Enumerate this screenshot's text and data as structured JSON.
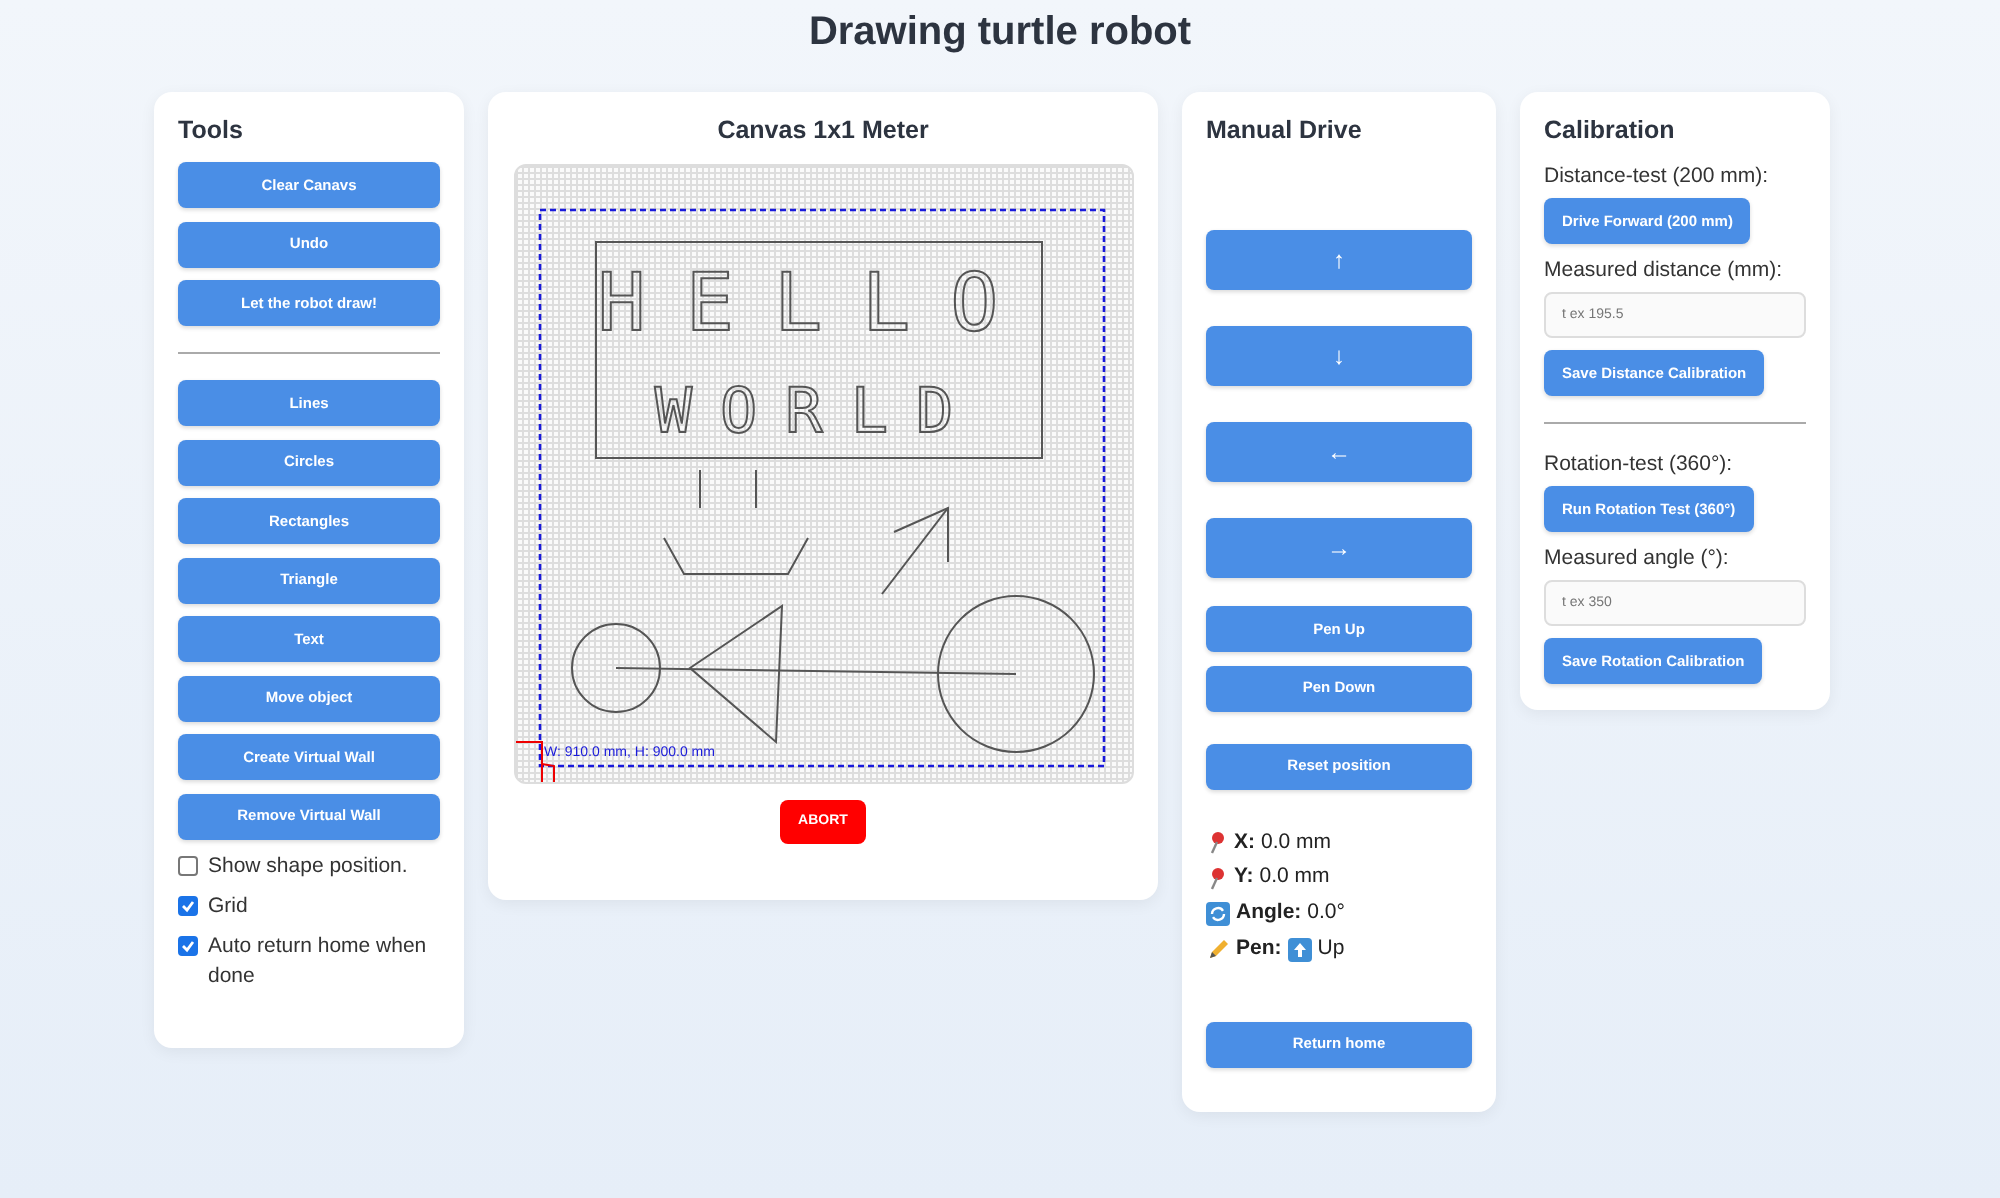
{
  "title": "Drawing turtle robot",
  "tools": {
    "title": "Tools",
    "buttons": [
      "Clear Canavs",
      "Undo",
      "Let the robot draw!"
    ],
    "shape_buttons": [
      "Lines",
      "Circles",
      "Rectangles",
      "Triangle",
      "Text",
      "Move object",
      "Create Virtual Wall",
      "Remove Virtual Wall"
    ],
    "options": [
      {
        "label": "Show shape position.",
        "checked": false
      },
      {
        "label": "Grid",
        "checked": true
      },
      {
        "label": "Auto return home when done",
        "checked": true
      }
    ]
  },
  "canvas": {
    "title": "Canvas 1x1 Meter",
    "grid": true,
    "text_lines": [
      "HELLO",
      "WORLD"
    ],
    "wall_label": "W: 910.0 mm, H: 900.0 mm",
    "abort_button": "ABORT"
  },
  "manual_drive": {
    "title": "Manual Drive",
    "arrows": [
      "↑",
      "↓",
      "←",
      "→"
    ],
    "buttons": [
      "Pen Up",
      "Pen Down"
    ],
    "reset_button": "Reset position",
    "status": [
      {
        "kind": "pin",
        "label": "X:",
        "value": "0.0 mm"
      },
      {
        "kind": "pin",
        "label": "Y:",
        "value": "0.0 mm"
      },
      {
        "kind": "rotate",
        "label": "Angle:",
        "value": "0.0°"
      },
      {
        "kind": "pen",
        "label": "Pen:",
        "value": "Up"
      }
    ],
    "home_button": "Return home"
  },
  "calibration": {
    "title": "Calibration",
    "sections": [
      {
        "label": "Distance-test (200 mm):",
        "test_button": "Drive Forward (200 mm)",
        "field_label": "Measured distance (mm):",
        "placeholder": "t ex 195.5",
        "save_button": "Save Distance Calibration"
      },
      {
        "label": "Rotation-test (360°):",
        "test_button": "Run Rotation Test (360°)",
        "field_label": "Measured angle (°):",
        "placeholder": "t ex 350",
        "save_button": "Save Rotation Calibration"
      }
    ]
  }
}
